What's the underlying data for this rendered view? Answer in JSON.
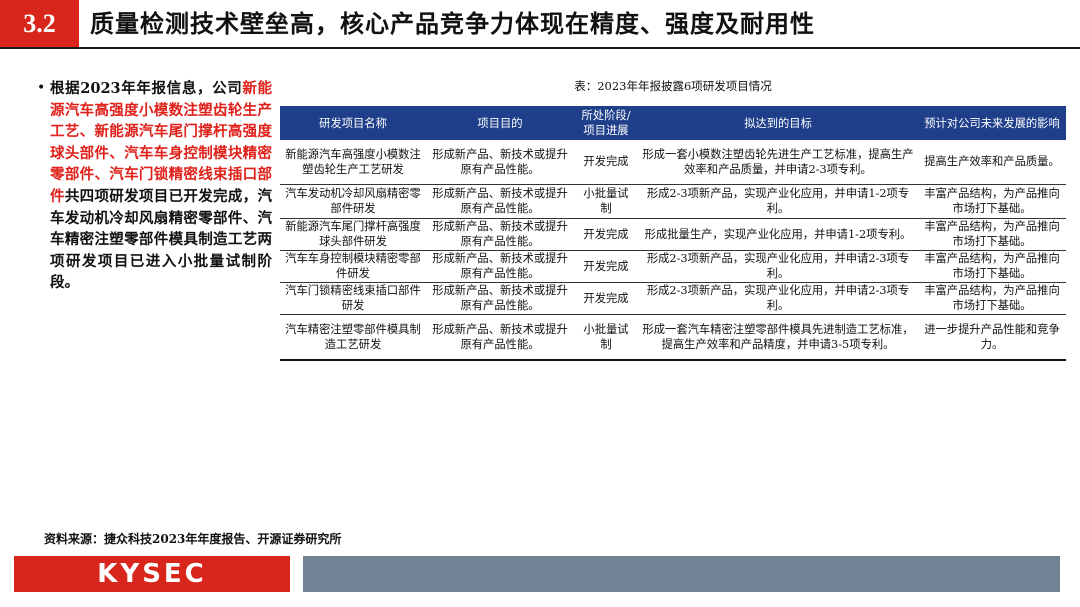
{
  "header": {
    "section_number": "3.2",
    "title": "质量检测技术壁垒高，核心产品竞争力体现在精度、强度及耐用性"
  },
  "bullet": {
    "marker": "•",
    "text_part1": "根据2023年年报信息，公司",
    "text_red": "新能源汽车高强度小模数注塑齿轮生产工艺、新能源汽车尾门撑杆高强度球头部件、汽车车身控制模块精密零部件、汽车门锁精密线束插口部件",
    "text_part2": "共四项研发项目已开发完成，汽车发动机冷却风扇精密零部件、汽车精密注塑零部件模具制造工艺两项研发项目已进入小批量试制阶段。"
  },
  "table": {
    "caption": "表：2023年年报披露6项研发项目情况",
    "headers": [
      "研发项目名称",
      "项目目的",
      "所处阶段/项目进展",
      "拟达到的目标",
      "预计对公司未来发展的影响"
    ],
    "rows": [
      [
        "新能源汽车高强度小模数注塑齿轮生产工艺研发",
        "形成新产品、新技术或提升原有产品性能。",
        "开发完成",
        "形成一套小模数注塑齿轮先进生产工艺标准，提高生产效率和产品质量，并申请2-3项专利。",
        "提高生产效率和产品质量。"
      ],
      [
        "汽车发动机冷却风扇精密零部件研发",
        "形成新产品、新技术或提升原有产品性能。",
        "小批量试制",
        "形成2-3项新产品，实现产业化应用，并申请1-2项专利。",
        "丰富产品结构，为产品推向市场打下基础。"
      ],
      [
        "新能源汽车尾门撑杆高强度球头部件研发",
        "形成新产品、新技术或提升原有产品性能。",
        "开发完成",
        "形成批量生产，实现产业化应用，并申请1-2项专利。",
        "丰富产品结构，为产品推向市场打下基础。"
      ],
      [
        "汽车车身控制模块精密零部件研发",
        "形成新产品、新技术或提升原有产品性能。",
        "开发完成",
        "形成2-3项新产品，实现产业化应用，并申请2-3项专利。",
        "丰富产品结构，为产品推向市场打下基础。"
      ],
      [
        "汽车门锁精密线束插口部件研发",
        "形成新产品、新技术或提升原有产品性能。",
        "开发完成",
        "形成2-3项新产品，实现产业化应用，并申请2-3项专利。",
        "丰富产品结构，为产品推向市场打下基础。"
      ],
      [
        "汽车精密注塑零部件模具制造工艺研发",
        "形成新产品、新技术或提升原有产品性能。",
        "小批量试制",
        "形成一套汽车精密注塑零部件模具先进制造工艺标准，提高生产效率和产品精度，并申请3-5项专利。",
        "进一步提升产品性能和竞争力。"
      ]
    ]
  },
  "source": "资料来源：捷众科技2023年年度报告、开源证券研究所",
  "footer": {
    "logo_text": "KYSEC"
  },
  "colors": {
    "accent_red": "#d9261c",
    "table_header_blue": "#1f3f8a",
    "footer_bar": "#6f8394",
    "highlight_red": "#e0201a"
  }
}
